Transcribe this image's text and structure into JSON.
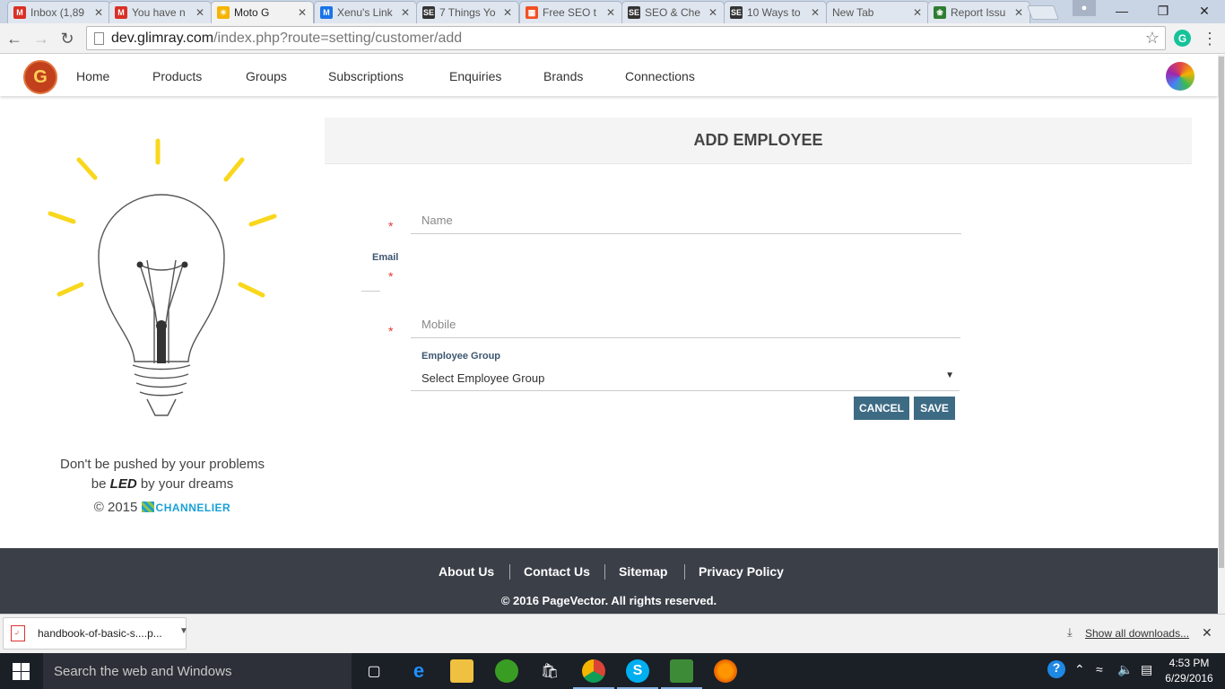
{
  "browser": {
    "tabs": [
      {
        "label": "Inbox (1,89",
        "icon": "gmail-icon",
        "color": "#d93025",
        "glyph": "M"
      },
      {
        "label": "You have n",
        "icon": "gmail-icon",
        "color": "#d93025",
        "glyph": "M"
      },
      {
        "label": "Moto G",
        "icon": "bulb-icon",
        "color": "#f4b400",
        "glyph": "☀",
        "active": true
      },
      {
        "label": "Xenu's Link",
        "icon": "xenu-icon",
        "color": "#1a73e8",
        "glyph": "M"
      },
      {
        "label": "7 Things Yo",
        "icon": "sej-icon",
        "color": "#333333",
        "glyph": "SE"
      },
      {
        "label": "Free SEO t",
        "icon": "windows-icon",
        "color": "#f25022",
        "glyph": "▦"
      },
      {
        "label": "SEO & Che",
        "icon": "sej-icon",
        "color": "#333333",
        "glyph": "SE"
      },
      {
        "label": "10 Ways to",
        "icon": "sej-icon",
        "color": "#333333",
        "glyph": "SE"
      },
      {
        "label": "New Tab",
        "icon": "",
        "color": "",
        "glyph": ""
      },
      {
        "label": "Report Issu",
        "icon": "bug-icon",
        "color": "#2e7d32",
        "glyph": "❀"
      }
    ],
    "url_host": "dev.glimray.com",
    "url_path": "/index.php?route=setting/customer/add"
  },
  "site_nav": {
    "logo_glyph": "G",
    "links": [
      "Home",
      "Products",
      "Groups",
      "Subscriptions",
      "Enquiries",
      "Brands",
      "Connections"
    ]
  },
  "left_panel": {
    "tagline_line1": "Don't be pushed by your problems",
    "tagline_be": "be",
    "tagline_led": "LED",
    "tagline_rest": "by your dreams",
    "copyright": "© 2015",
    "brand": "CHANNELIER"
  },
  "form": {
    "title": "ADD EMPLOYEE",
    "required_mark": "*",
    "name_placeholder": "Name",
    "email_label": "Email",
    "mobile_placeholder": "Mobile",
    "employee_group_label": "Employee Group",
    "employee_group_value": "Select Employee Group",
    "cancel_label": "CANCEL",
    "save_label": "SAVE"
  },
  "footer": {
    "links": [
      "About Us",
      "Contact Us",
      "Sitemap",
      "Privacy Policy"
    ],
    "copyright": "© 2016 PageVector. All rights reserved."
  },
  "downloads": {
    "file": "handbook-of-basic-s....p...",
    "show_all": "Show all downloads..."
  },
  "taskbar": {
    "search_placeholder": "Search the web and Windows",
    "time": "4:53 PM",
    "date": "6/29/2016"
  },
  "colors": {
    "button": "#3d6b84",
    "footer": "#3a3f48",
    "required": "#e53935",
    "bulb_rays": "#f9d71c"
  }
}
